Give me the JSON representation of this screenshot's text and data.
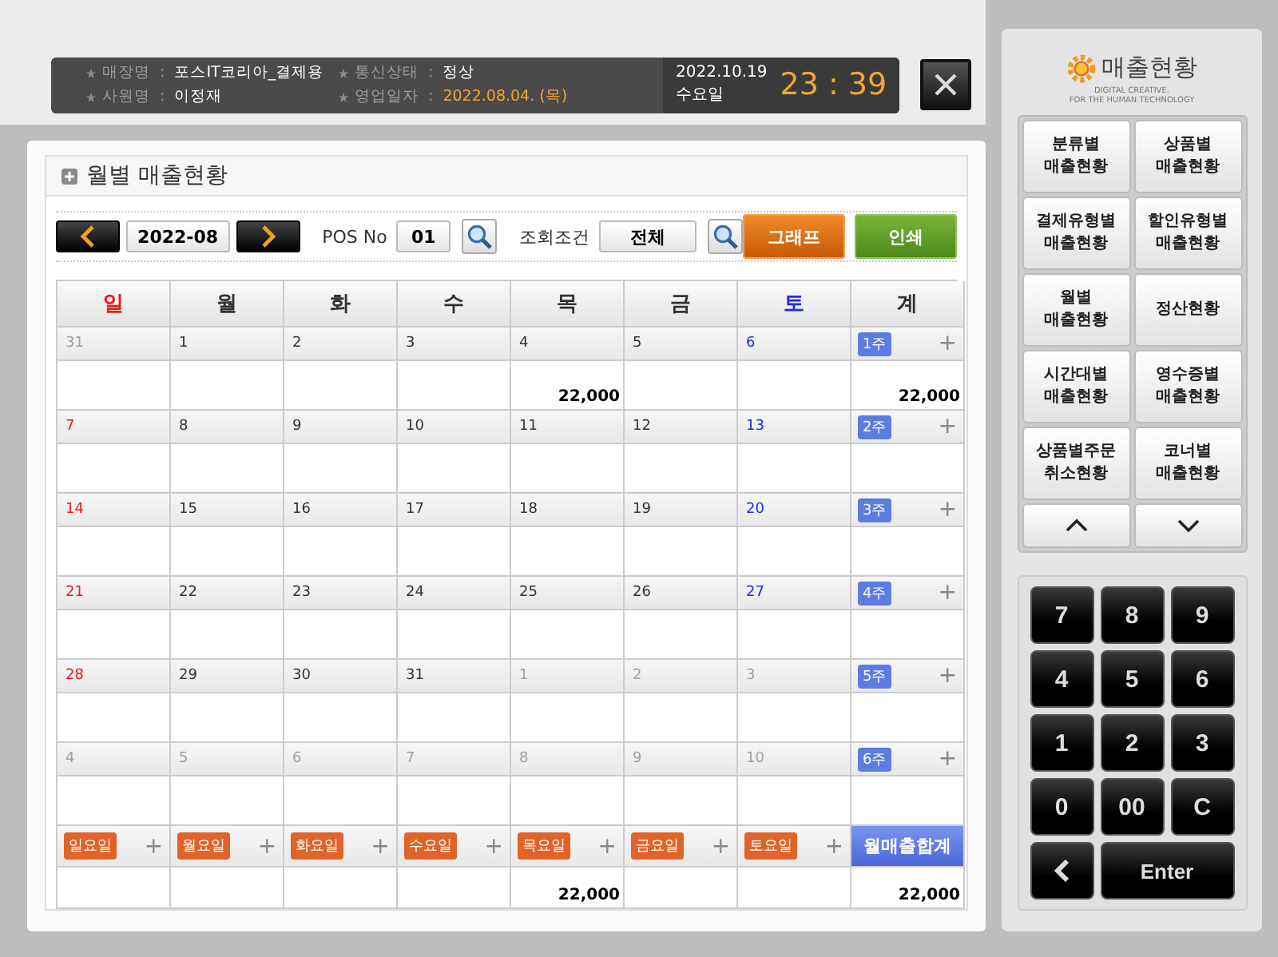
{
  "header": {
    "fields": [
      {
        "label": "매장명",
        "colon": ":",
        "value": "포스IT코리아_결제용",
        "highlight": false
      },
      {
        "label": "통신상태",
        "colon": ":",
        "value": "정상",
        "highlight": false
      },
      {
        "label": "사원명",
        "colon": ":",
        "value": "이정재",
        "highlight": false
      },
      {
        "label": "영업일자",
        "colon": ":",
        "value": "2022.08.04. (목)",
        "highlight": true
      }
    ],
    "date": "2022.10.19",
    "weekday": "수요일",
    "time": "23 : 39"
  },
  "title": "월별 매출현황",
  "toolbar": {
    "month": "2022-08",
    "pos_label": "POS No",
    "pos_value": "01",
    "filter_label": "조회조건",
    "filter_value": "전체",
    "buttons": [
      {
        "label": "그래프",
        "kind": "orange"
      },
      {
        "label": "인쇄",
        "kind": "green"
      }
    ]
  },
  "calendar": {
    "headers": [
      {
        "label": "일"
      },
      {
        "label": "월"
      },
      {
        "label": "화"
      },
      {
        "label": "수"
      },
      {
        "label": "목"
      },
      {
        "label": "금"
      },
      {
        "label": "토"
      },
      {
        "label": "계"
      }
    ],
    "weeks": [
      {
        "days": [
          {
            "day": "31",
            "in_month": false
          },
          {
            "day": "1",
            "in_month": true
          },
          {
            "day": "2",
            "in_month": true
          },
          {
            "day": "3",
            "in_month": true
          },
          {
            "day": "4",
            "in_month": true,
            "amount": "22,000"
          },
          {
            "day": "5",
            "in_month": true
          },
          {
            "day": "6",
            "in_month": true
          }
        ],
        "week_label": "1주",
        "expand": "+",
        "total": "22,000"
      },
      {
        "days": [
          {
            "day": "7",
            "in_month": true
          },
          {
            "day": "8",
            "in_month": true
          },
          {
            "day": "9",
            "in_month": true
          },
          {
            "day": "10",
            "in_month": true
          },
          {
            "day": "11",
            "in_month": true
          },
          {
            "day": "12",
            "in_month": true
          },
          {
            "day": "13",
            "in_month": true
          }
        ],
        "week_label": "2주",
        "expand": "+"
      },
      {
        "days": [
          {
            "day": "14",
            "in_month": true
          },
          {
            "day": "15",
            "in_month": true
          },
          {
            "day": "16",
            "in_month": true
          },
          {
            "day": "17",
            "in_month": true
          },
          {
            "day": "18",
            "in_month": true
          },
          {
            "day": "19",
            "in_month": true
          },
          {
            "day": "20",
            "in_month": true
          }
        ],
        "week_label": "3주",
        "expand": "+"
      },
      {
        "days": [
          {
            "day": "21",
            "in_month": true
          },
          {
            "day": "22",
            "in_month": true
          },
          {
            "day": "23",
            "in_month": true
          },
          {
            "day": "24",
            "in_month": true
          },
          {
            "day": "25",
            "in_month": true
          },
          {
            "day": "26",
            "in_month": true
          },
          {
            "day": "27",
            "in_month": true
          }
        ],
        "week_label": "4주",
        "expand": "+"
      },
      {
        "days": [
          {
            "day": "28",
            "in_month": true
          },
          {
            "day": "29",
            "in_month": true
          },
          {
            "day": "30",
            "in_month": true
          },
          {
            "day": "31",
            "in_month": true
          },
          {
            "day": "1",
            "in_month": false
          },
          {
            "day": "2",
            "in_month": false
          },
          {
            "day": "3",
            "in_month": false
          }
        ],
        "week_label": "5주",
        "expand": "+"
      },
      {
        "days": [
          {
            "day": "4",
            "in_month": false
          },
          {
            "day": "5",
            "in_month": false
          },
          {
            "day": "6",
            "in_month": false
          },
          {
            "day": "7",
            "in_month": false
          },
          {
            "day": "8",
            "in_month": false
          },
          {
            "day": "9",
            "in_month": false
          },
          {
            "day": "10",
            "in_month": false
          }
        ],
        "week_label": "6주",
        "expand": "+"
      }
    ],
    "footer": {
      "days": [
        {
          "label": "일요일",
          "expand": "+"
        },
        {
          "label": "월요일",
          "expand": "+"
        },
        {
          "label": "화요일",
          "expand": "+"
        },
        {
          "label": "수요일",
          "expand": "+"
        },
        {
          "label": "목요일",
          "expand": "+",
          "amount": "22,000"
        },
        {
          "label": "금요일",
          "expand": "+"
        },
        {
          "label": "토요일",
          "expand": "+"
        }
      ],
      "total_label": "월매출합계",
      "total": "22,000"
    }
  },
  "side": {
    "logo": "매출현황",
    "tagline": [
      "DIGITAL CREATIVE.",
      "FOR THE HUMAN TECHNOLOGY"
    ],
    "menu": [
      {
        "label": "분류별\n매출현황"
      },
      {
        "label": "상품별\n매출현황"
      },
      {
        "label": "결제유형별\n매출현황"
      },
      {
        "label": "할인유형별\n매출현황"
      },
      {
        "label": "월별\n매출현황"
      },
      {
        "label": "정산현황"
      },
      {
        "label": "시간대별\n매출현황"
      },
      {
        "label": "영수증별\n매출현황"
      },
      {
        "label": "상품별주문\n취소현황"
      },
      {
        "label": "코너별\n매출현황"
      }
    ],
    "arrows": [
      {
        "kind": "up"
      },
      {
        "kind": "down"
      }
    ],
    "keypad": [
      {
        "kind": "key",
        "label": "7"
      },
      {
        "kind": "key",
        "label": "8"
      },
      {
        "kind": "key",
        "label": "9"
      },
      {
        "kind": "key",
        "label": "4"
      },
      {
        "kind": "key",
        "label": "5"
      },
      {
        "kind": "key",
        "label": "6"
      },
      {
        "kind": "key",
        "label": "1"
      },
      {
        "kind": "key",
        "label": "2"
      },
      {
        "kind": "key",
        "label": "3"
      },
      {
        "kind": "key",
        "label": "0"
      },
      {
        "kind": "key",
        "label": "00"
      },
      {
        "kind": "key",
        "label": "C"
      },
      {
        "kind": "back"
      },
      {
        "kind": "wide",
        "label": "Enter"
      }
    ]
  }
}
